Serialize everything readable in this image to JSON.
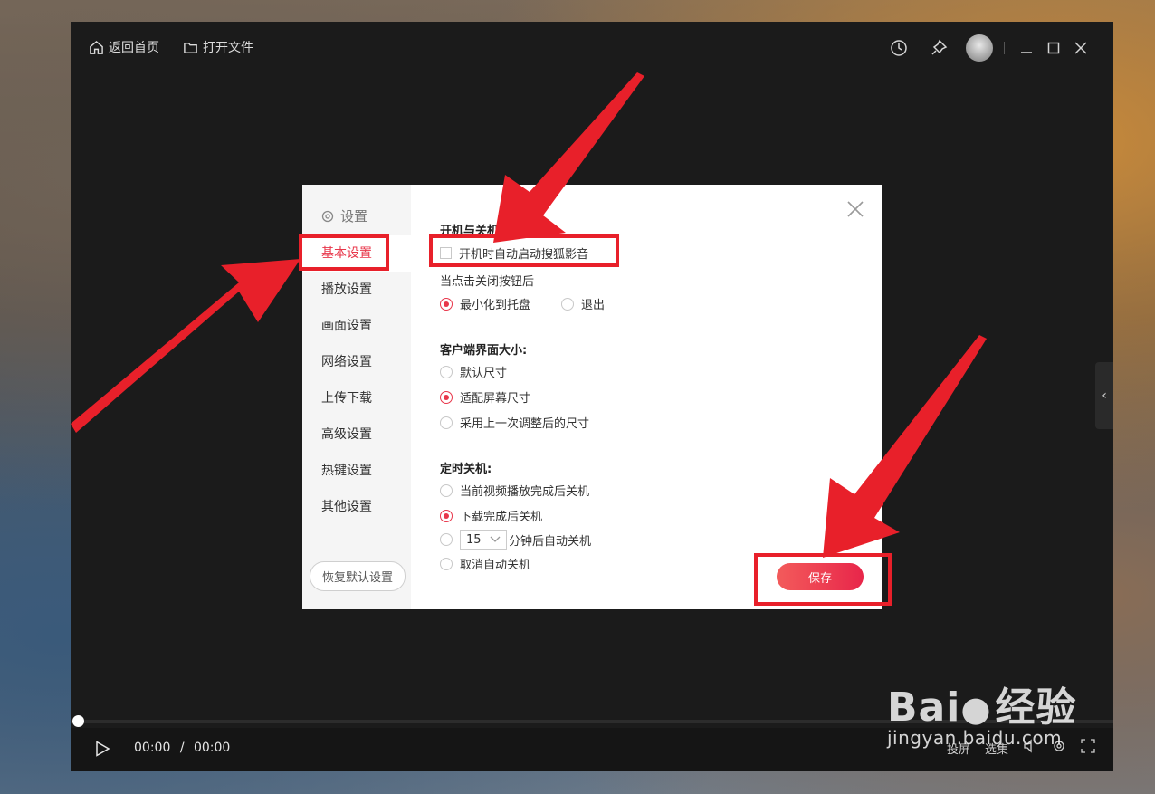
{
  "topbar": {
    "home_label": "返回首页",
    "open_file_label": "打开文件"
  },
  "player": {
    "time_current": "00:00",
    "time_separator": "/",
    "time_total": "00:00",
    "cast_label": "投屏",
    "episodes_label": "选集"
  },
  "settings": {
    "title": "设置",
    "nav": [
      {
        "label": "基本设置",
        "active": true
      },
      {
        "label": "播放设置"
      },
      {
        "label": "画面设置"
      },
      {
        "label": "网络设置"
      },
      {
        "label": "上传下载"
      },
      {
        "label": "高级设置"
      },
      {
        "label": "热键设置"
      },
      {
        "label": "其他设置"
      }
    ],
    "restore_label": "恢复默认设置",
    "startup_section": "开机与关机",
    "autostart_label": "开机时自动启动搜狐影音",
    "close_button_label": "当点击关闭按钮后",
    "close_options": [
      "最小化到托盘",
      "退出"
    ],
    "size_section": "客户端界面大小:",
    "size_options": [
      "默认尺寸",
      "适配屏幕尺寸",
      "采用上一次调整后的尺寸"
    ],
    "shutdown_section": "定时关机:",
    "shutdown_options": [
      "当前视频播放完成后关机",
      "下载完成后关机",
      "分钟后自动关机",
      "取消自动关机"
    ],
    "shutdown_minutes": "15",
    "save_label": "保存"
  },
  "watermark": {
    "brand_text": "Bai",
    "brand_suffix": "经验",
    "url": "jingyan.baidu.com"
  },
  "colors": {
    "accent": "#e8364a",
    "annotation": "#e8202a"
  }
}
